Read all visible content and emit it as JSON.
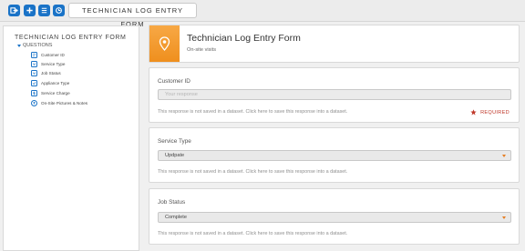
{
  "toolbar": {
    "title": "TECHNICIAN LOG ENTRY FORM",
    "buttons": [
      {
        "icon": "exit-icon"
      },
      {
        "icon": "add-icon"
      },
      {
        "icon": "list-icon"
      },
      {
        "icon": "share-icon"
      }
    ]
  },
  "sidebar": {
    "title": "TECHNICIAN LOG ENTRY FORM",
    "section": "QUESTIONS",
    "items": [
      {
        "label": "Customer ID",
        "icon": "text-field-icon"
      },
      {
        "label": "Service Type",
        "icon": "dropdown-icon"
      },
      {
        "label": "Job Status",
        "icon": "dropdown-icon"
      },
      {
        "label": "Appliance Type",
        "icon": "checkbox-icon"
      },
      {
        "label": "Service Charge",
        "icon": "currency-icon"
      },
      {
        "label": "On-Site Pictures & Notes",
        "icon": "upload-icon"
      }
    ]
  },
  "header": {
    "icon": "location-pin-icon",
    "title": "Technician Log Entry Form",
    "subtitle": "On-site visits"
  },
  "questions": [
    {
      "label": "Customer ID",
      "placeholder": "Your response",
      "note": "This response is not saved in a dataset. Click here to save this response into a dataset.",
      "required_label": "REQUIRED"
    },
    {
      "label": "Service Type",
      "value": "Updpate",
      "note": "This response is not saved in a dataset. Click here to save this response into a dataset."
    },
    {
      "label": "Job Status",
      "value": "Complete",
      "note": "This response is not saved in a dataset. Click here to save this response into a dataset."
    }
  ],
  "colors": {
    "accent": "#1a73c7",
    "header_orange": "#f29a2e",
    "required_red": "#c0392b"
  }
}
